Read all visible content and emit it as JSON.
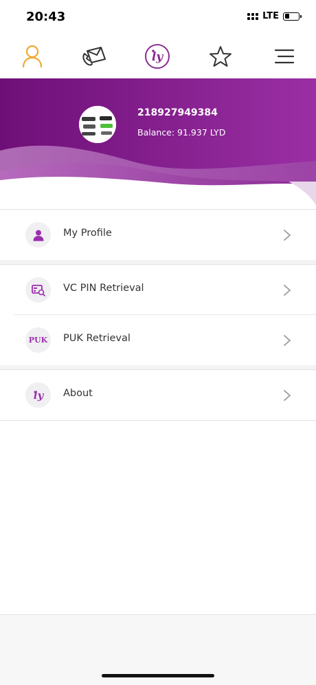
{
  "status_bar": {
    "time": "20:43",
    "network": "LTE",
    "battery_level": 0.35
  },
  "top_nav": {
    "items": [
      {
        "name": "profile-icon",
        "color": "#f0a830"
      },
      {
        "name": "messages-icon",
        "color": "#333333"
      },
      {
        "name": "brand-logo-icon",
        "color": "#8a2c8f"
      },
      {
        "name": "favorites-star-icon",
        "color": "#333333"
      },
      {
        "name": "menu-icon",
        "color": "#333333"
      }
    ]
  },
  "header": {
    "phone_number": "218927949384",
    "balance": "Balance: 91.937 LYD"
  },
  "menu": {
    "groups": [
      {
        "items": [
          {
            "label": "My Profile",
            "icon": "user-icon"
          }
        ]
      },
      {
        "items": [
          {
            "label": "VC PIN Retrieval",
            "icon": "card-search-icon"
          },
          {
            "label": "PUK Retrieval",
            "icon": "puk-icon",
            "icon_text": "PUK"
          }
        ]
      },
      {
        "items": [
          {
            "label": "About",
            "icon": "brand-logo-icon"
          }
        ]
      }
    ]
  },
  "colors": {
    "brand_purple": "#8a1f8f",
    "accent_orange": "#f0a830",
    "icon_purple": "#9b2fae"
  }
}
